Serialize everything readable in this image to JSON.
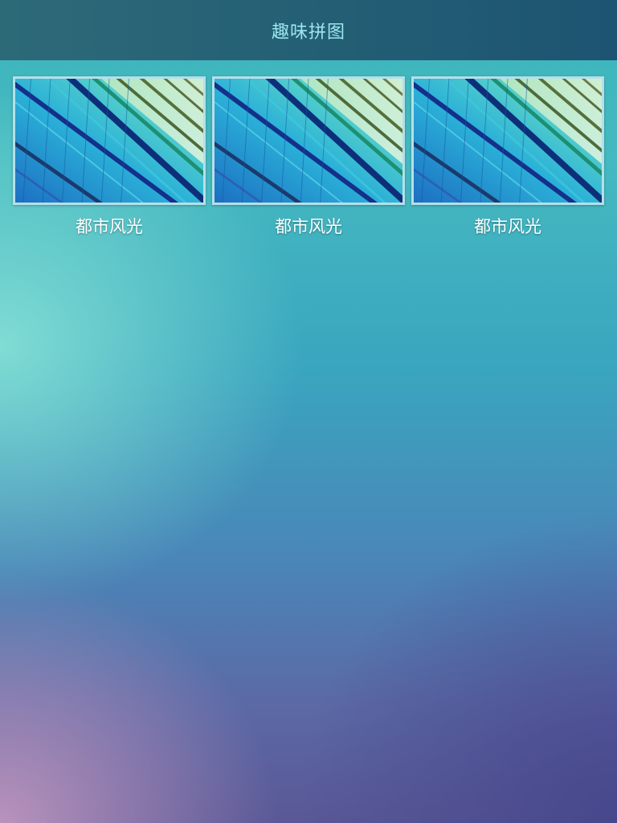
{
  "header": {
    "title": "趣味拼图"
  },
  "gallery": {
    "items": [
      {
        "label": "都市风光",
        "image": "glass-building-facade"
      },
      {
        "label": "都市风光",
        "image": "glass-building-facade"
      },
      {
        "label": "都市风光",
        "image": "glass-building-facade"
      }
    ]
  }
}
